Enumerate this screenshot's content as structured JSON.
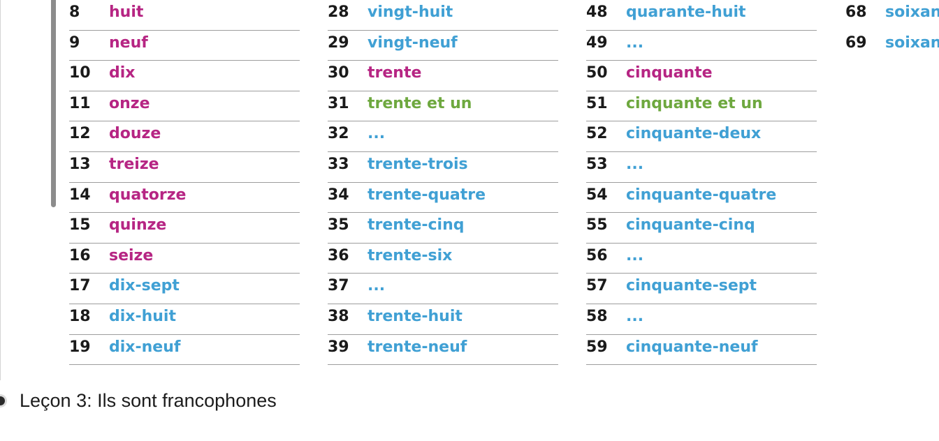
{
  "colors": {
    "pink": "#b62583",
    "blue": "#40a0d4",
    "green": "#6ea83f",
    "number": "#1a1a1a",
    "rule": "#9d9d9d"
  },
  "columns": [
    {
      "rows": [
        {
          "num": "8",
          "word": "huit",
          "color": "pink"
        },
        {
          "num": "9",
          "word": "neuf",
          "color": "pink"
        },
        {
          "num": "10",
          "word": "dix",
          "color": "pink"
        },
        {
          "num": "11",
          "word": "onze",
          "color": "pink"
        },
        {
          "num": "12",
          "word": "douze",
          "color": "pink"
        },
        {
          "num": "13",
          "word": "treize",
          "color": "pink"
        },
        {
          "num": "14",
          "word": "quatorze",
          "color": "pink"
        },
        {
          "num": "15",
          "word": "quinze",
          "color": "pink"
        },
        {
          "num": "16",
          "word": "seize",
          "color": "pink"
        },
        {
          "num": "17",
          "word": "dix-sept",
          "color": "blue"
        },
        {
          "num": "18",
          "word": "dix-huit",
          "color": "blue"
        },
        {
          "num": "19",
          "word": "dix-neuf",
          "color": "blue"
        }
      ]
    },
    {
      "rows": [
        {
          "num": "28",
          "word": "vingt-huit",
          "color": "blue"
        },
        {
          "num": "29",
          "word": "vingt-neuf",
          "color": "blue"
        },
        {
          "num": "30",
          "word": "trente",
          "color": "pink"
        },
        {
          "num": "31",
          "word": "trente et un",
          "color": "green"
        },
        {
          "num": "32",
          "word": "...",
          "color": "blue"
        },
        {
          "num": "33",
          "word": "trente-trois",
          "color": "blue"
        },
        {
          "num": "34",
          "word": "trente-quatre",
          "color": "blue"
        },
        {
          "num": "35",
          "word": "trente-cinq",
          "color": "blue"
        },
        {
          "num": "36",
          "word": "trente-six",
          "color": "blue"
        },
        {
          "num": "37",
          "word": "...",
          "color": "blue"
        },
        {
          "num": "38",
          "word": "trente-huit",
          "color": "blue"
        },
        {
          "num": "39",
          "word": "trente-neuf",
          "color": "blue"
        }
      ]
    },
    {
      "rows": [
        {
          "num": "48",
          "word": "quarante-huit",
          "color": "blue"
        },
        {
          "num": "49",
          "word": "...",
          "color": "blue"
        },
        {
          "num": "50",
          "word": "cinquante",
          "color": "pink"
        },
        {
          "num": "51",
          "word": "cinquante et un",
          "color": "green"
        },
        {
          "num": "52",
          "word": "cinquante-deux",
          "color": "blue"
        },
        {
          "num": "53",
          "word": "...",
          "color": "blue"
        },
        {
          "num": "54",
          "word": "cinquante-quatre",
          "color": "blue"
        },
        {
          "num": "55",
          "word": "cinquante-cinq",
          "color": "blue"
        },
        {
          "num": "56",
          "word": "...",
          "color": "blue"
        },
        {
          "num": "57",
          "word": "cinquante-sept",
          "color": "blue"
        },
        {
          "num": "58",
          "word": "...",
          "color": "blue"
        },
        {
          "num": "59",
          "word": "cinquante-neuf",
          "color": "blue"
        }
      ]
    },
    {
      "rows": [
        {
          "num": "68",
          "word": "soixan",
          "color": "blue"
        },
        {
          "num": "69",
          "word": "soixan",
          "color": "blue"
        }
      ]
    }
  ],
  "lesson": {
    "title": "Leçon 3: Ils sont francophones"
  }
}
